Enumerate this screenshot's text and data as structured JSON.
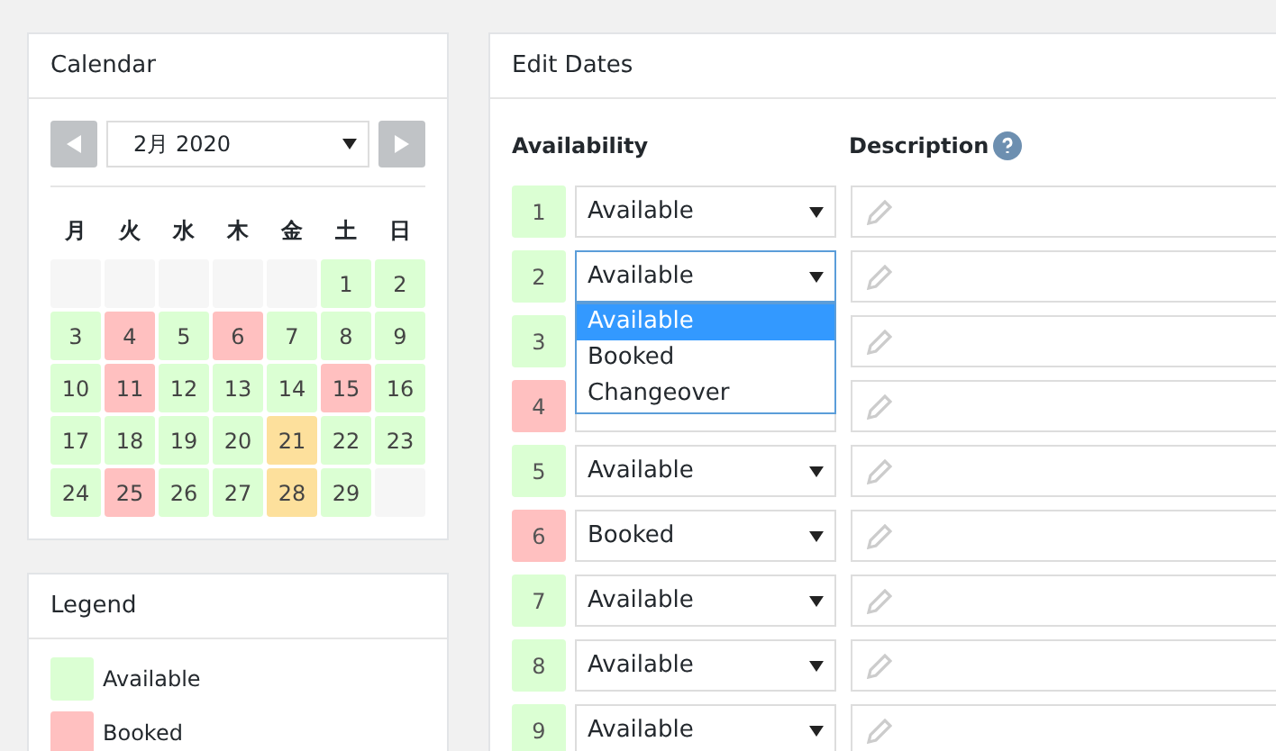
{
  "calendar": {
    "title": "Calendar",
    "month": "2月 2020",
    "weekdays": [
      "月",
      "火",
      "水",
      "木",
      "金",
      "土",
      "日"
    ],
    "weeks": [
      [
        {
          "color": "#f6f6f6"
        },
        {
          "color": "#f6f6f6"
        },
        {
          "color": "#f6f6f6"
        },
        {
          "color": "#f6f6f6"
        },
        {
          "color": "#f6f6f6"
        },
        {
          "day": "1",
          "color": "#dbffd3"
        },
        {
          "day": "2",
          "color": "#dbffd3"
        }
      ],
      [
        {
          "day": "3",
          "color": "#dbffd3"
        },
        {
          "day": "4",
          "color": "#ffc0c0"
        },
        {
          "day": "5",
          "color": "#dbffd3"
        },
        {
          "day": "6",
          "color": "#ffc0c0"
        },
        {
          "day": "7",
          "color": "#dbffd3"
        },
        {
          "day": "8",
          "color": "#dbffd3"
        },
        {
          "day": "9",
          "color": "#dbffd3"
        }
      ],
      [
        {
          "day": "10",
          "color": "#dbffd3"
        },
        {
          "day": "11",
          "color": "#ffc0c0"
        },
        {
          "day": "12",
          "color": "#dbffd3"
        },
        {
          "day": "13",
          "color": "#dbffd3"
        },
        {
          "day": "14",
          "color": "#dbffd3"
        },
        {
          "day": "15",
          "color": "#ffc0c0"
        },
        {
          "day": "16",
          "color": "#dbffd3"
        }
      ],
      [
        {
          "day": "17",
          "color": "#dbffd3"
        },
        {
          "day": "18",
          "color": "#dbffd3"
        },
        {
          "day": "19",
          "color": "#dbffd3"
        },
        {
          "day": "20",
          "color": "#dbffd3"
        },
        {
          "day": "21",
          "color": "#fde09c"
        },
        {
          "day": "22",
          "color": "#dbffd3"
        },
        {
          "day": "23",
          "color": "#dbffd3"
        }
      ],
      [
        {
          "day": "24",
          "color": "#dbffd3"
        },
        {
          "day": "25",
          "color": "#ffc0c0"
        },
        {
          "day": "26",
          "color": "#dbffd3"
        },
        {
          "day": "27",
          "color": "#dbffd3"
        },
        {
          "day": "28",
          "color": "#fde09c"
        },
        {
          "day": "29",
          "color": "#dbffd3"
        },
        {
          "color": "#f6f6f6"
        }
      ]
    ]
  },
  "legend": {
    "title": "Legend",
    "items": [
      {
        "label": "Available",
        "color": "#dbffd3"
      },
      {
        "label": "Booked",
        "color": "#ffc0c0"
      }
    ]
  },
  "edit_dates": {
    "title": "Edit Dates",
    "columns": [
      "Availability",
      "Description"
    ],
    "rows": [
      {
        "day": "1",
        "color": "#dbffd3",
        "value": "Available"
      },
      {
        "day": "2",
        "color": "#dbffd3",
        "value": "Available",
        "open": true,
        "options": [
          {
            "label": "Available",
            "selected": true
          },
          {
            "label": "Booked",
            "selected": false
          },
          {
            "label": "Changeover",
            "selected": false
          }
        ]
      },
      {
        "day": "3",
        "color": "#dbffd3"
      },
      {
        "day": "4",
        "color": "#ffc0c0"
      },
      {
        "day": "5",
        "color": "#dbffd3",
        "value": "Available"
      },
      {
        "day": "6",
        "color": "#ffc0c0",
        "value": "Booked"
      },
      {
        "day": "7",
        "color": "#dbffd3",
        "value": "Available"
      },
      {
        "day": "8",
        "color": "#dbffd3",
        "value": "Available"
      },
      {
        "day": "9",
        "color": "#dbffd3",
        "value": "Available"
      }
    ]
  }
}
